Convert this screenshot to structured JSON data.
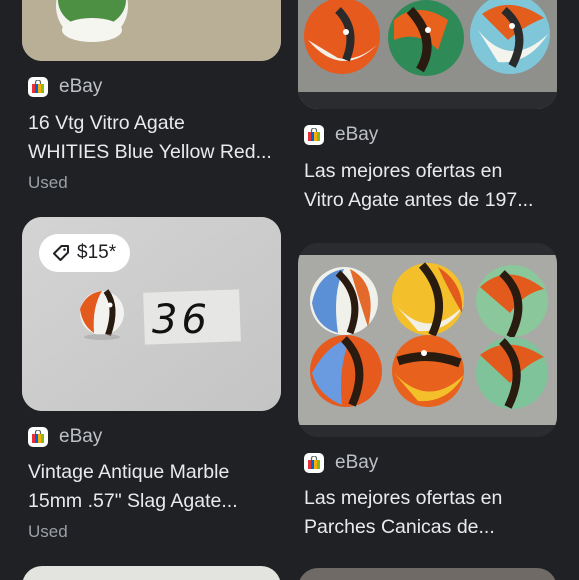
{
  "results": [
    {
      "source": "eBay",
      "title_line1": "16 Vtg Vitro Agate",
      "title_line2": "WHITIES Blue Yellow Red...",
      "condition": "Used"
    },
    {
      "source": "eBay",
      "title_line1": "Las mejores ofertas en",
      "title_line2": "Vitro Agate antes de 197..."
    },
    {
      "source": "eBay",
      "price": "$15*",
      "image_text": "36",
      "title_line1": "Vintage Antique Marble",
      "title_line2": "15mm .57\" Slag Agate...",
      "condition": "Used"
    },
    {
      "source": "eBay",
      "title_line1": "Las mejores ofertas en",
      "title_line2": "Parches Canicas de..."
    }
  ],
  "colors": {
    "background": "#202124",
    "text_primary": "#e8eaed",
    "text_secondary": "#9aa0a6",
    "ebay_red": "#e53238",
    "ebay_blue": "#0064d2",
    "ebay_yellow": "#f5af02",
    "ebay_green": "#86b817"
  },
  "icons": {
    "source_icon": "ebay-shopping-bag-icon",
    "price_icon": "price-tag-icon"
  }
}
